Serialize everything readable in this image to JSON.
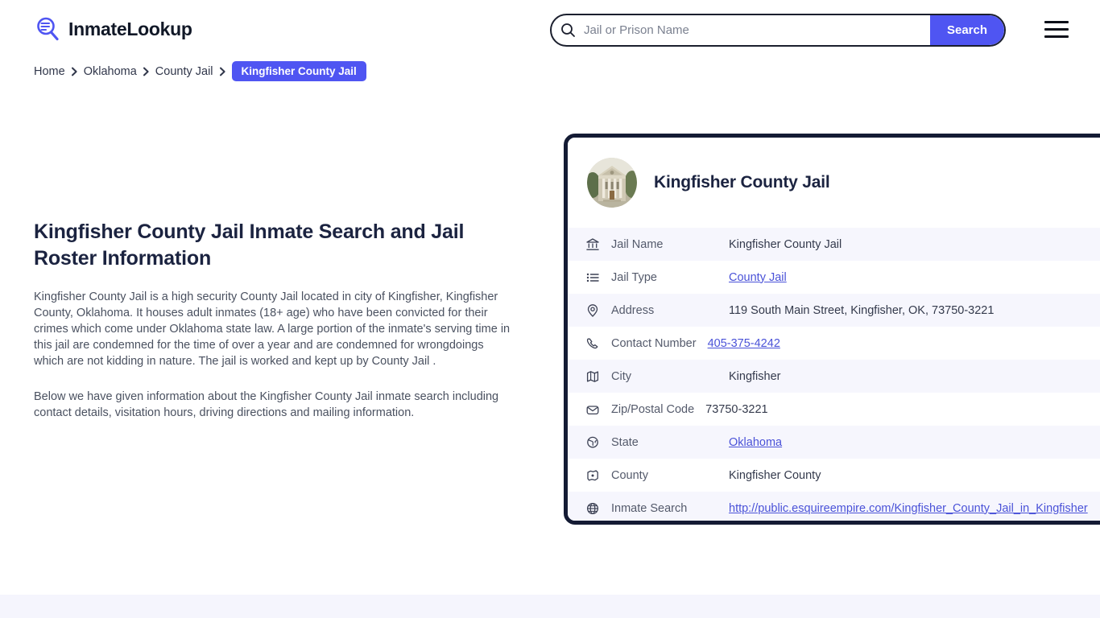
{
  "header": {
    "brand_name": "InmateLookup",
    "brand_icon": "search-list-icon",
    "menu_icon": "hamburger-menu-icon"
  },
  "search": {
    "icon": "search-icon",
    "placeholder": "Jail or Prison Name",
    "value": "",
    "button_label": "Search"
  },
  "breadcrumb": {
    "items": [
      {
        "label": "Home",
        "current": false
      },
      {
        "label": "Oklahoma",
        "current": false
      },
      {
        "label": "County Jail",
        "current": false
      },
      {
        "label": "Kingfisher County Jail",
        "current": true
      }
    ]
  },
  "main": {
    "page_title": "Kingfisher County Jail Inmate Search and Jail Roster Information",
    "paragraph_1": "Kingfisher County Jail is a high security County Jail located in city of Kingfisher, Kingfisher County, Oklahoma. It houses adult inmates (18+ age) who have been convicted for their crimes which come under Oklahoma state law. A large portion of the inmate's serving time in this jail are condemned for the time of over a year and are condemned for wrongdoings which are not kidding in nature. The jail is worked and kept up by County Jail .",
    "paragraph_2": "Below we have given information about the Kingfisher County Jail inmate search including contact details, visitation hours, driving directions and mailing information."
  },
  "info_card": {
    "avatar_icon": "courthouse-photo",
    "title": "Kingfisher County Jail",
    "rows": [
      {
        "icon": "bank-icon",
        "label": "Jail Name",
        "value": "Kingfisher County Jail",
        "is_link": false
      },
      {
        "icon": "list-icon",
        "label": "Jail Type",
        "value": "County Jail",
        "is_link": true
      },
      {
        "icon": "map-pin-icon",
        "label": "Address",
        "value": "119 South Main Street, Kingfisher, OK, 73750-3221",
        "is_link": false
      },
      {
        "icon": "phone-icon",
        "label": "Contact Number",
        "value": "405-375-4242",
        "is_link": true
      },
      {
        "icon": "map-icon",
        "label": "City",
        "value": "Kingfisher",
        "is_link": false
      },
      {
        "icon": "envelope-icon",
        "label": "Zip/Postal Code",
        "value": "73750-3221",
        "is_link": false
      },
      {
        "icon": "globe-pin-icon",
        "label": "State",
        "value": "Oklahoma",
        "is_link": true
      },
      {
        "icon": "county-icon",
        "label": "County",
        "value": "Kingfisher County",
        "is_link": false
      },
      {
        "icon": "globe-icon",
        "label": "Inmate Search",
        "value": "http://public.esquireempire.com/Kingfisher_County_Jail_in_Kingfisher",
        "is_link": true
      }
    ]
  },
  "colors": {
    "accent": "#4f55f2",
    "card_border": "#141b34",
    "row_alt_bg": "#f6f6fd",
    "link": "#4a52d8",
    "heading": "#1b2340",
    "body_text": "#4a5160",
    "footer_bg": "#f5f5fd"
  }
}
